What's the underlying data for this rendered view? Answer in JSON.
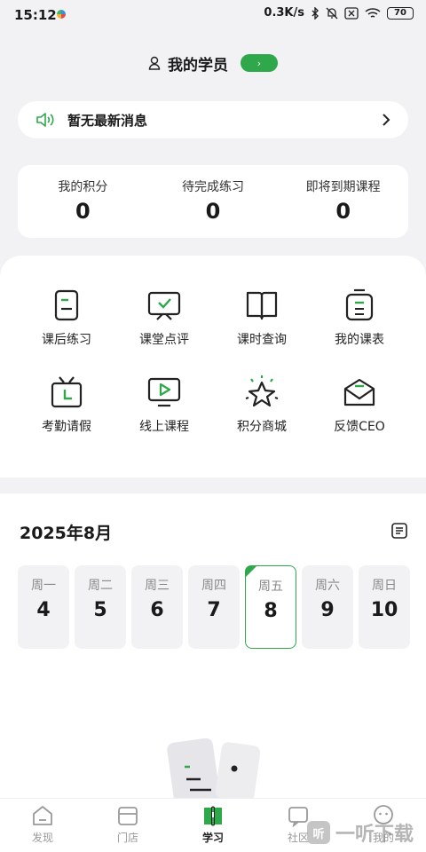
{
  "status_bar": {
    "time": "15:12",
    "speed": "0.3K/s",
    "battery": "70"
  },
  "header": {
    "title": "我的学员",
    "toggle_glyph": "›"
  },
  "notice": {
    "text": "暂无最新消息",
    "icon": "speaker-icon"
  },
  "stats": [
    {
      "label": "我的积分",
      "value": "0"
    },
    {
      "label": "待完成练习",
      "value": "0"
    },
    {
      "label": "即将到期课程",
      "value": "0"
    }
  ],
  "menu": [
    {
      "label": "课后练习",
      "icon": "homework-icon"
    },
    {
      "label": "课堂点评",
      "icon": "review-icon"
    },
    {
      "label": "课时查询",
      "icon": "book-icon"
    },
    {
      "label": "我的课表",
      "icon": "schedule-icon"
    },
    {
      "label": "考勤请假",
      "icon": "attendance-icon"
    },
    {
      "label": "线上课程",
      "icon": "online-course-icon"
    },
    {
      "label": "积分商城",
      "icon": "points-mall-icon"
    },
    {
      "label": "反馈CEO",
      "icon": "feedback-icon"
    }
  ],
  "calendar": {
    "title": "2025年8月",
    "days": [
      {
        "name": "周一",
        "num": "4"
      },
      {
        "name": "周二",
        "num": "5"
      },
      {
        "name": "周三",
        "num": "6"
      },
      {
        "name": "周四",
        "num": "7"
      },
      {
        "name": "周五",
        "num": "8"
      },
      {
        "name": "周六",
        "num": "9"
      },
      {
        "name": "周日",
        "num": "10"
      }
    ],
    "selected_day": "8"
  },
  "tabbar": [
    {
      "label": "发现",
      "icon": "discover-icon"
    },
    {
      "label": "门店",
      "icon": "store-icon"
    },
    {
      "label": "学习",
      "icon": "study-icon",
      "active": true
    },
    {
      "label": "社区",
      "icon": "community-icon"
    },
    {
      "label": "我的",
      "icon": "profile-icon"
    }
  ],
  "watermark": {
    "text": "一听下载"
  },
  "colors": {
    "accent": "#2ea84a",
    "background": "#f2f2f5",
    "text": "#1a1a1a"
  }
}
